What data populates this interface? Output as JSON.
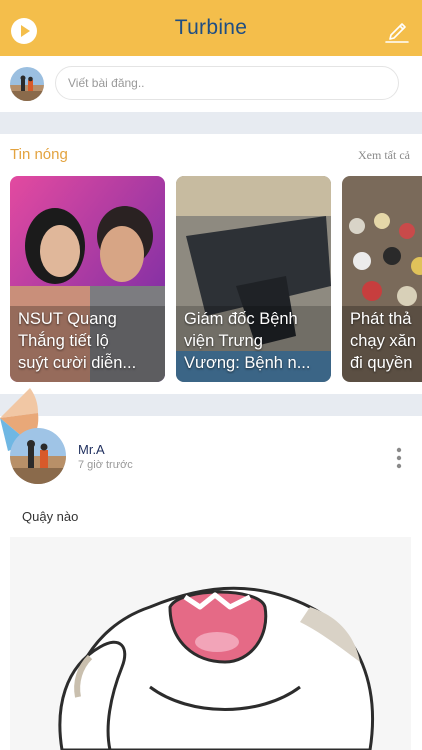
{
  "header": {
    "title": "Turbine",
    "play_icon": "play-icon",
    "edit_icon": "pencil-icon",
    "bg_color": "#f4be4b",
    "title_color": "#1f4e83"
  },
  "composer": {
    "placeholder": "Viết bài đăng.."
  },
  "hot_news": {
    "title": "Tin nóng",
    "see_all": "Xem tất cả",
    "items": [
      {
        "line1": "NSUT Quang",
        "line2": "Thắng tiết lộ",
        "line3": "suýt cười diễn..."
      },
      {
        "line1": "Giám đốc Bệnh",
        "line2": "viện Trưng",
        "line3": "Vương: Bệnh n..."
      },
      {
        "line1": "Phát thả",
        "line2": "chạy xăn",
        "line3": "đi quyền"
      }
    ]
  },
  "post": {
    "author": "Mr.A",
    "time": "7 giờ trước",
    "text": "Quậy nào",
    "more_icon": "more-vertical-icon"
  }
}
